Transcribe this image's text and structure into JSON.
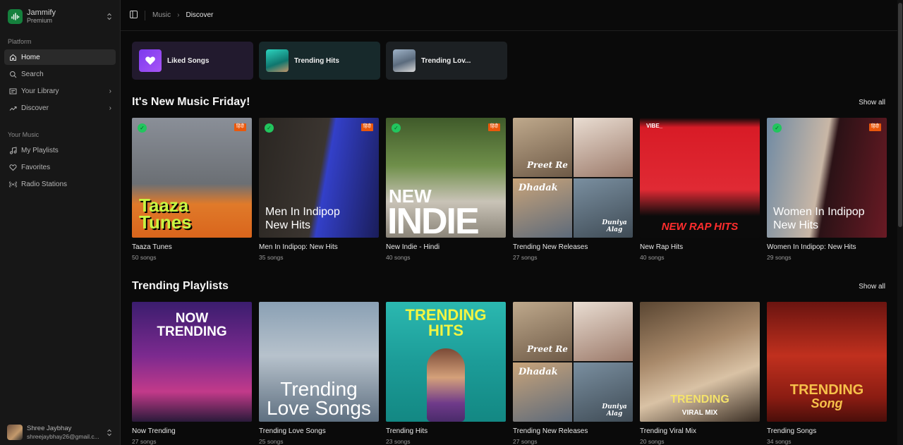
{
  "brand": {
    "name": "Jammify",
    "plan": "Premium"
  },
  "sidebar": {
    "platform_label": "Platform",
    "platform_items": [
      {
        "label": "Home"
      },
      {
        "label": "Search"
      },
      {
        "label": "Your Library"
      },
      {
        "label": "Discover"
      }
    ],
    "music_label": "Your Music",
    "music_items": [
      {
        "label": "My Playlists"
      },
      {
        "label": "Favorites"
      },
      {
        "label": "Radio Stations"
      }
    ]
  },
  "user": {
    "name": "Shree Jaybhay",
    "email": "shreejaybhay26@gmail.c..."
  },
  "breadcrumb": {
    "parent": "Music",
    "current": "Discover"
  },
  "quick_access": [
    {
      "label": "Liked Songs"
    },
    {
      "label": "Trending Hits"
    },
    {
      "label": "Trending Lov..."
    }
  ],
  "sections": [
    {
      "title": "It's New Music Friday!",
      "show_all": "Show all",
      "items": [
        {
          "title": "Taaza Tunes",
          "count": "50 songs",
          "cover_text": "Taaza Tunes",
          "hindi_badge": "हिंदी"
        },
        {
          "title": "Men In Indipop: New Hits",
          "count": "35 songs",
          "cover_text": "Men In Indipop New Hits",
          "hindi_badge": "हिंदी"
        },
        {
          "title": "New Indie - Hindi",
          "count": "40 songs",
          "cover_text_top": "NEW",
          "cover_text_bottom": "INDIE",
          "hindi_badge": "हिंदी"
        },
        {
          "title": "Trending New Releases",
          "count": "27 songs",
          "tile_texts": [
            "Preet Re",
            "",
            "Dhadak",
            "Duniya Alag"
          ]
        },
        {
          "title": "New Rap Hits",
          "count": "40 songs",
          "cover_text": "NEW RAP HITS",
          "vibe": "VIBE_"
        },
        {
          "title": "Women In Indipop: New Hits",
          "count": "29 songs",
          "cover_text": "Women In Indipop New Hits",
          "hindi_badge": "हिंदी"
        }
      ]
    },
    {
      "title": "Trending Playlists",
      "show_all": "Show all",
      "items": [
        {
          "title": "Now Trending",
          "count": "27 songs",
          "cover_text": "NOW TRENDING"
        },
        {
          "title": "Trending Love Songs",
          "count": "25 songs",
          "cover_text": "Trending Love Songs"
        },
        {
          "title": "Trending Hits",
          "count": "23 songs",
          "cover_text": "TRENDING HITS"
        },
        {
          "title": "Trending New Releases",
          "count": "27 songs",
          "tile_texts": [
            "Preet Re",
            "",
            "Dhadak",
            "Duniya Alag"
          ]
        },
        {
          "title": "Trending Viral Mix",
          "count": "20 songs",
          "cover_text_top": "TRENDING",
          "cover_text_bottom": "VIRAL MIX"
        },
        {
          "title": "Trending Songs",
          "count": "34 songs",
          "cover_text_top": "TRENDING",
          "cover_text_bottom": "Song"
        }
      ]
    }
  ],
  "colors": {
    "accent_green": "#15803d",
    "liked_purple": "#8b3ddb",
    "hindi_badge": "#ea580c",
    "bg": "#0a0a0a",
    "sidebar_bg": "#171717"
  },
  "icons": [
    "music-logo-icon",
    "chevrons-updown-icon",
    "sidebar-toggle-icon",
    "home-icon",
    "search-icon",
    "library-icon",
    "trending-icon",
    "chevron-right-icon",
    "playlist-icon",
    "heart-icon",
    "radio-icon"
  ]
}
